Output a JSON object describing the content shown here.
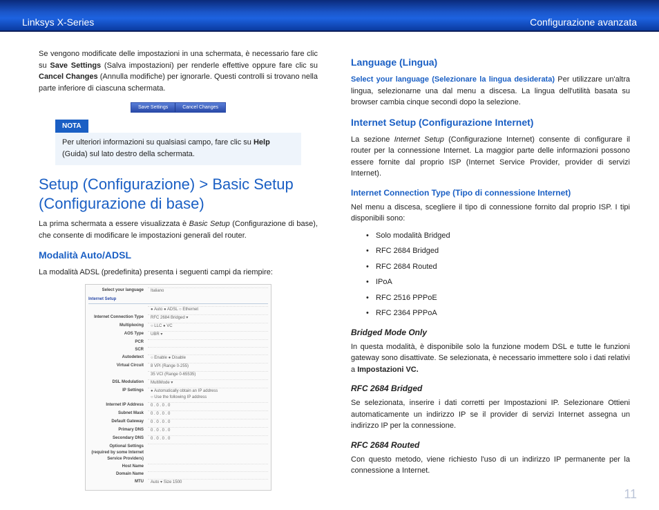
{
  "header": {
    "left": "Linksys X-Series",
    "right": "Configurazione avanzata"
  },
  "left": {
    "intro_parts": {
      "a": "Se vengono modificate delle impostazioni in una schermata, è necessario fare clic su ",
      "b": "Save Settings",
      "c": " (Salva impostazioni) per renderle effettive oppure fare clic su ",
      "d": "Cancel Changes",
      "e": " (Annulla modifiche) per ignorarle. Questi controlli si trovano nella parte inferiore di ciascuna schermata."
    },
    "btn_save": "Save Settings",
    "btn_cancel": "Cancel Changes",
    "note_head": "NOTA",
    "note_parts": {
      "a": "Per ulteriori informazioni su qualsiasi campo, fare clic su ",
      "b": "Help",
      "c": " (Guida) sul lato destro della schermata."
    },
    "h1": "Setup (Configurazione) > Basic Setup (Configurazione di base)",
    "p1_parts": {
      "a": "La prima schermata a essere visualizzata è ",
      "b": "Basic Setup",
      "c": " (Configurazione di base), che consente di modificare le impostazioni generali del router."
    },
    "h2": "Modalità Auto/ADSL",
    "p2": "La modalità ADSL (predefinita) presenta i seguenti campi da riempire:",
    "screenshot": {
      "lang_lbl": "Select your language",
      "lang_val": "Italiano",
      "section_internet": "Internet Setup",
      "radios": "● Auto  ● ADSL  ○ Ethernet",
      "conn_lbl": "Internet Connection Type",
      "conn_val": "RFC 2684 Bridged  ▾",
      "rows": [
        {
          "k": "Multiplexing",
          "v": "○ LLC  ● VC"
        },
        {
          "k": "AOS Type",
          "v": "UBR  ▾"
        },
        {
          "k": "PCR",
          "v": ""
        },
        {
          "k": "SCR",
          "v": ""
        },
        {
          "k": "Autodetect",
          "v": "○ Enable  ● Disable"
        },
        {
          "k": "Virtual Circuit",
          "v": "8    VPI (Range 0-255)"
        },
        {
          "k": "",
          "v": "35   VCI (Range 0-65535)"
        },
        {
          "k": "DSL Modulation",
          "v": "MultiMode  ▾"
        }
      ],
      "ip_lbl": "IP Settings",
      "ip_radio": "● Automatically obtain an IP address\n○ Use the following IP address",
      "ip_rows": [
        {
          "k": "Internet IP Address",
          "v": "0 . 0 . 0 . 0"
        },
        {
          "k": "Subnet Mask",
          "v": "0 . 0 . 0 . 0"
        },
        {
          "k": "Default Gateway",
          "v": "0 . 0 . 0 . 0"
        },
        {
          "k": "Primary DNS",
          "v": "0 . 0 . 0 . 0"
        },
        {
          "k": "Secondary DNS",
          "v": "0 . 0 . 0 . 0"
        }
      ],
      "opt_lbl": "Optional Settings\n(required by some Internet Service Providers)",
      "opt_rows": [
        {
          "k": "Host Name",
          "v": ""
        },
        {
          "k": "Domain Name",
          "v": ""
        },
        {
          "k": "MTU",
          "v": "Auto  ▾   Size  1500"
        }
      ]
    }
  },
  "right": {
    "h2a": "Language (Lingua)",
    "p_a_parts": {
      "a": "Select your language (Selezionare la lingua desiderata)",
      "b": " Per utilizzare un'altra lingua, selezionarne una dal menu a discesa. La lingua dell'utilità basata su browser cambia cinque secondi dopo la selezione."
    },
    "h2b": "Internet Setup (Configurazione Internet)",
    "p_b_parts": {
      "a": "La sezione ",
      "b": "Internet Setup",
      "c": " (Configurazione Internet) consente di configurare il router per la connessione Internet. La maggior parte delle informazioni possono essere fornite dal proprio ISP (Internet Service Provider, provider di servizi Internet)."
    },
    "h3": "Internet Connection Type (Tipo di connessione Internet)",
    "p_c": "Nel menu a discesa, scegliere il tipo di connessione fornito dal proprio ISP. I tipi disponibili sono:",
    "list": [
      "Solo modalità Bridged",
      "RFC 2684 Bridged",
      "RFC 2684 Routed",
      "IPoA",
      "RFC 2516 PPPoE",
      "RFC 2364 PPPoA"
    ],
    "h4a": "Bridged Mode Only",
    "p_d_parts": {
      "a": "In questa modalità, è disponibile solo la funzione modem DSL e tutte le funzioni gateway sono disattivate. Se selezionata, è necessario immettere solo i dati relativi a ",
      "b": "Impostazioni VC."
    },
    "h4b": "RFC 2684 Bridged",
    "p_e": "Se selezionata, inserire i dati corretti per Impostazioni IP. Selezionare Ottieni automaticamente un indirizzo IP se il provider di servizi Internet assegna un indirizzo IP per la connessione.",
    "h4c": "RFC 2684 Routed",
    "p_f": "Con questo metodo, viene richiesto l'uso di un indirizzo IP permanente per la connessione a Internet."
  },
  "page": "11"
}
